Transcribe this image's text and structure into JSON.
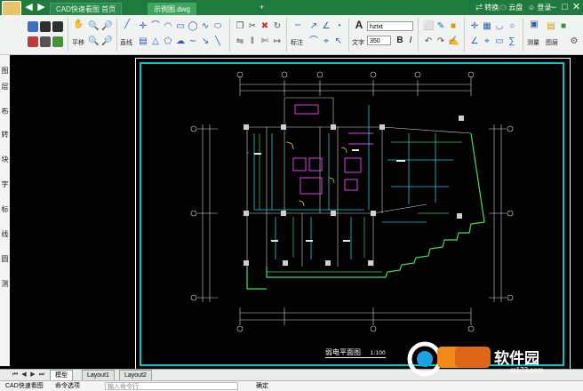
{
  "titlebar": {
    "tabs": [
      {
        "label": "CAD快速看图 首页"
      },
      {
        "label": "示例图.dwg"
      }
    ],
    "right_items": [
      {
        "label": "转换"
      },
      {
        "label": "云盘"
      },
      {
        "label": "登录"
      }
    ],
    "accent": "#1f7a3d"
  },
  "toolbar": {
    "groups": [
      {
        "label": "平移"
      },
      {
        "label": "直线"
      },
      {
        "label": "标注"
      },
      {
        "label": "文字"
      },
      {
        "label": "测量"
      },
      {
        "label": "图层"
      }
    ],
    "font_name": "hztxt",
    "font_size": "350"
  },
  "sidebar": {
    "items": [
      "图",
      "层",
      "布",
      "转",
      "块",
      "字",
      "标",
      "线",
      "圆",
      "测"
    ]
  },
  "drawing": {
    "title": "弱电平面图",
    "scale": "1:100"
  },
  "layouts": {
    "tabs": [
      {
        "label": "模型"
      },
      {
        "label": "Layout1"
      },
      {
        "label": "Layout2"
      }
    ]
  },
  "command": {
    "left": "CAD快速看图",
    "mid": "命令选项",
    "prompt": "输入命令行",
    "confirm": "确定"
  },
  "watermark": {
    "brand": "软件园",
    "site": "cr173.com"
  }
}
